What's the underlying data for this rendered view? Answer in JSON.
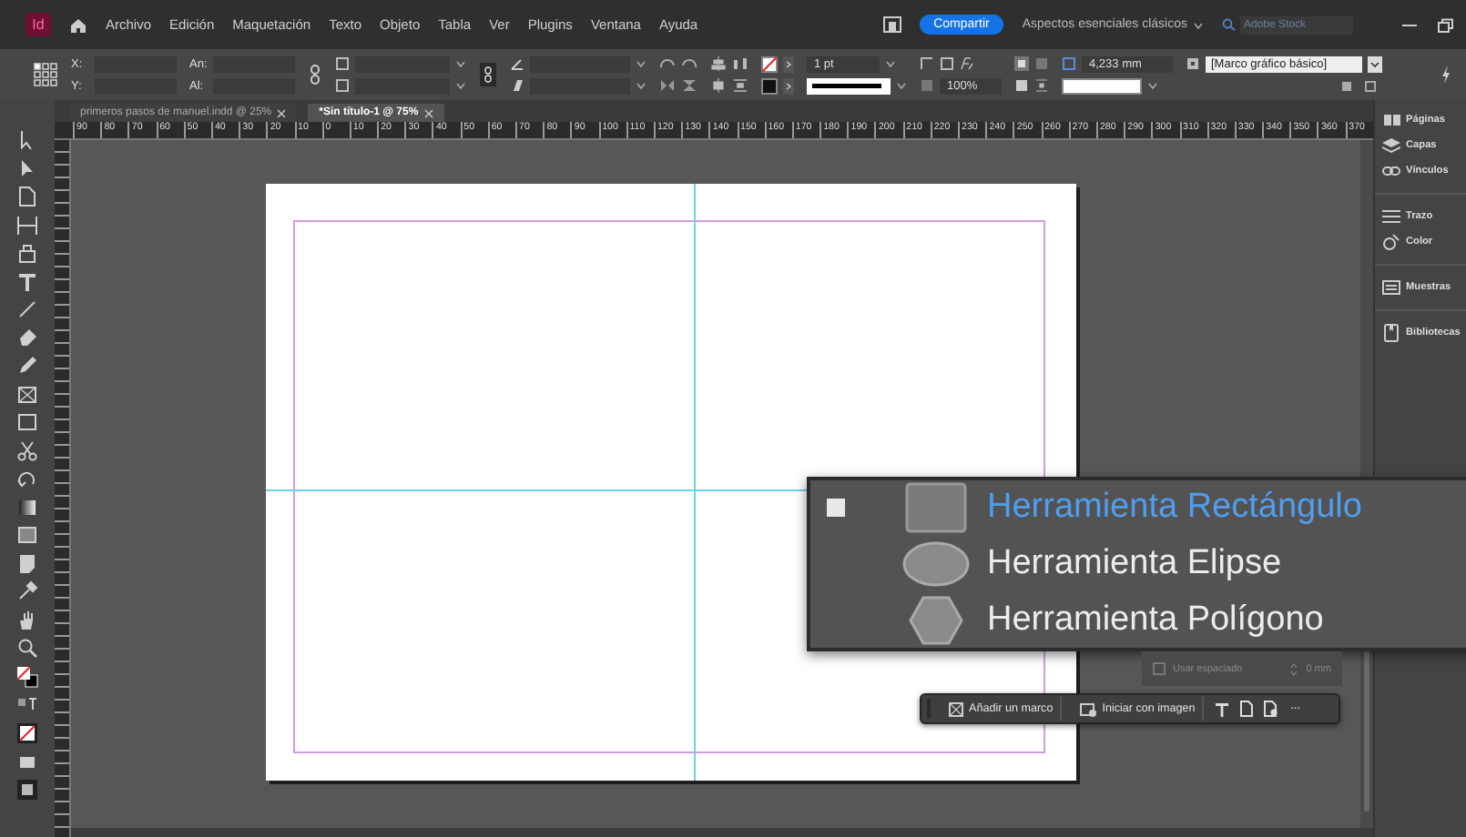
{
  "app": {
    "logo": "Id"
  },
  "menu": [
    "Archivo",
    "Edición",
    "Maquetación",
    "Texto",
    "Objeto",
    "Tabla",
    "Ver",
    "Plugins",
    "Ventana",
    "Ayuda"
  ],
  "header": {
    "share": "Compartir",
    "workspace": "Aspectos esenciales clásicos",
    "search": {
      "placeholder": "Adobe Stock"
    }
  },
  "control_bar": {
    "x_label": "X:",
    "y_label": "Y:",
    "w_label": "An:",
    "h_label": "Al:",
    "stroke_weight": "1 pt",
    "opacity": "100%",
    "offset": "4,233 mm",
    "object_style": "[Marco gráfico básico]"
  },
  "tabs": [
    {
      "label": "primeros pasos de manuel.indd @ 25%",
      "selected": false
    },
    {
      "label": "*Sin título-1 @ 75%",
      "selected": true
    }
  ],
  "ruler": {
    "labels": [
      "90",
      "80",
      "70",
      "60",
      "50",
      "40",
      "30",
      "20",
      "10",
      "0",
      "10",
      "20",
      "30",
      "40",
      "50",
      "60",
      "70",
      "80",
      "90",
      "100",
      "110",
      "120",
      "130",
      "140",
      "150",
      "160",
      "170",
      "180",
      "190",
      "200",
      "210",
      "220",
      "230",
      "240",
      "250",
      "260",
      "270",
      "280",
      "290",
      "300",
      "310",
      "320",
      "330",
      "340",
      "350",
      "360",
      "370"
    ]
  },
  "dock": [
    {
      "label": "Páginas"
    },
    {
      "label": "Capas"
    },
    {
      "label": "Vínculos"
    },
    {
      "label": "Trazo"
    },
    {
      "label": "Color"
    },
    {
      "label": "Muestras"
    },
    {
      "label": "Bibliotecas"
    }
  ],
  "flyout": {
    "items": [
      {
        "kind": "rectangle",
        "label": "Herramienta Rectángulo",
        "selected": true
      },
      {
        "kind": "ellipse",
        "label": "Herramienta Elipse",
        "selected": false
      },
      {
        "kind": "polygon",
        "label": "Herramienta Polígono",
        "selected": false
      }
    ]
  },
  "frame_fitting": {
    "checked": false,
    "checkbox_label": "Usar espaciado",
    "value": "0 mm"
  },
  "taskbar": {
    "add_frame": "Añadir un marco",
    "start_image": "Iniciar con imagen",
    "more": "···"
  }
}
